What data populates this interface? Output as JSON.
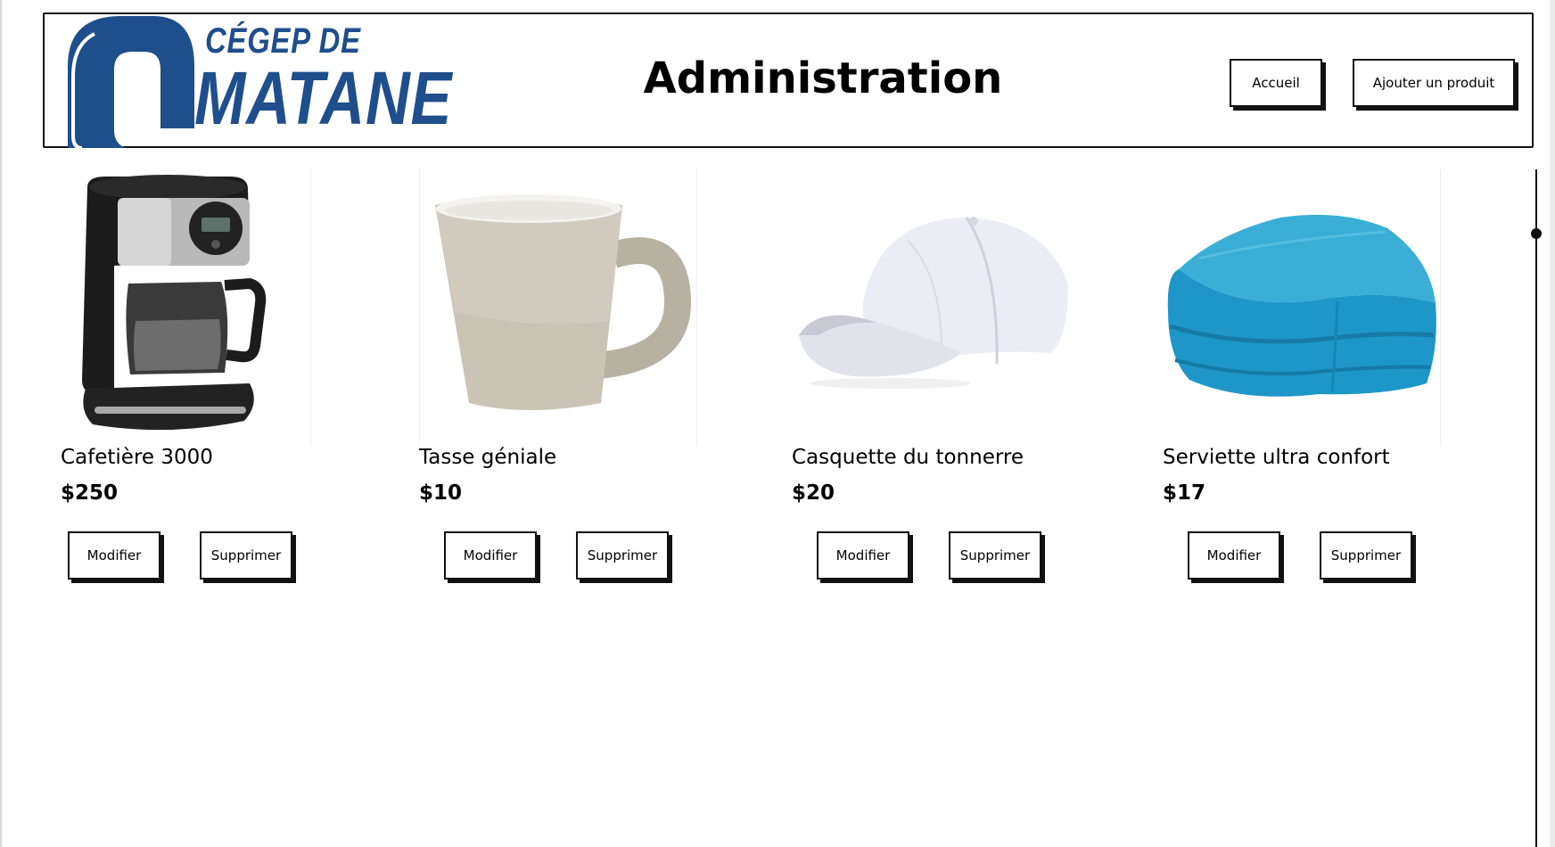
{
  "header": {
    "logo_line1": "CÉGEP DE",
    "logo_line2": "MATANE",
    "title": "Administration",
    "buttons": {
      "home": "Accueil",
      "add_product": "Ajouter un produit"
    }
  },
  "colors": {
    "brand_blue": "#1f4e8c",
    "border": "#111111"
  },
  "products": [
    {
      "name": "Cafetière 3000",
      "price": "$250",
      "edit": "Modifier",
      "delete": "Supprimer",
      "image": "coffee-maker-image"
    },
    {
      "name": "Tasse géniale",
      "price": "$10",
      "edit": "Modifier",
      "delete": "Supprimer",
      "image": "mug-image"
    },
    {
      "name": "Casquette du tonnerre",
      "price": "$20",
      "edit": "Modifier",
      "delete": "Supprimer",
      "image": "cap-image"
    },
    {
      "name": "Serviette ultra confort",
      "price": "$17",
      "edit": "Modifier",
      "delete": "Supprimer",
      "image": "blanket-image"
    }
  ]
}
